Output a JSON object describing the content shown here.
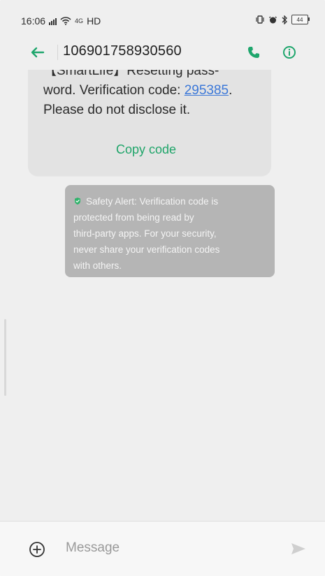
{
  "status_bar": {
    "time": "16:06",
    "network_small": "4G",
    "hd": "HD",
    "battery": "44"
  },
  "header": {
    "sender": "106901758930560"
  },
  "message": {
    "line1_prefix": "【SmartLife】Resetting pass-",
    "line2_prefix": "word. Verification code: ",
    "code": "295385",
    "line2_suffix": ".",
    "line3": "Please do not disclose it.",
    "copy_code_label": "Copy code"
  },
  "safety_alert": {
    "line1": "Safety Alert: Verification code is",
    "line2": "protected from being read by",
    "line3": "third-party apps. For your security,",
    "line4": "never share your verification codes",
    "line5": "with others."
  },
  "composer": {
    "placeholder": "Message"
  },
  "icons": {
    "back": "back-arrow-icon",
    "call": "phone-icon",
    "info": "info-icon",
    "add": "add-circle-icon",
    "send": "send-icon",
    "shield": "shield-check-icon",
    "signal": "signal-icon",
    "wifi": "wifi-icon",
    "vibrate": "vibrate-icon",
    "alarm": "alarm-icon",
    "bluetooth": "bluetooth-icon"
  },
  "colors": {
    "accent": "#1fa66d",
    "link": "#3c78d8",
    "bubble": "#e3e3e3",
    "alert_bg": "#b5b5b5",
    "background": "#efefef"
  }
}
